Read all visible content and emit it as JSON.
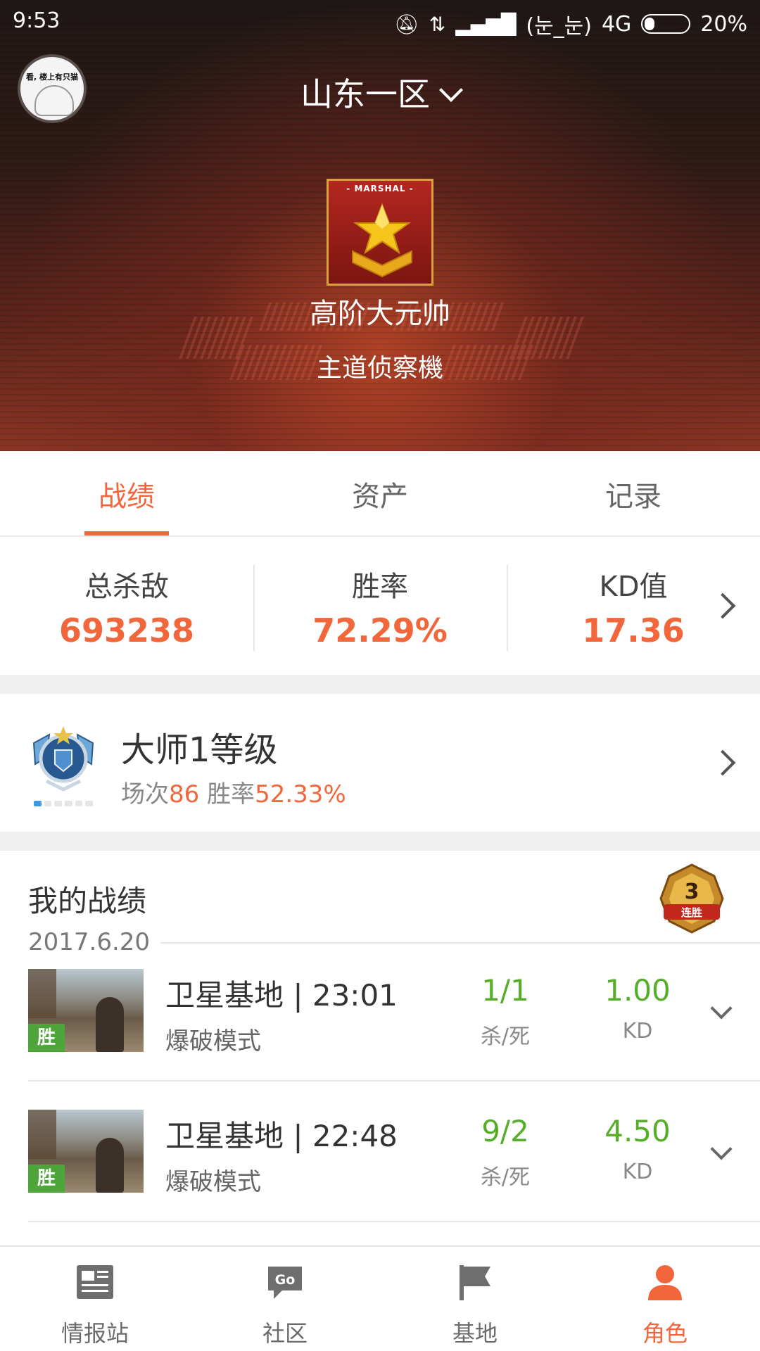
{
  "status_bar": {
    "time": "9:53",
    "carrier_face": "(눈_눈)",
    "network": "4G",
    "battery": "20%"
  },
  "header": {
    "server": "山东一区",
    "avatar_text": "看, 楼上有只猫",
    "rank_ribbon": "MARSHAL",
    "rank_name": "高阶大元帅",
    "player_name": "主道侦察機"
  },
  "tabs": [
    {
      "label": "战绩",
      "active": true
    },
    {
      "label": "资产",
      "active": false
    },
    {
      "label": "记录",
      "active": false
    }
  ],
  "stats": [
    {
      "label": "总杀敌",
      "value": "693238"
    },
    {
      "label": "胜率",
      "value": "72.29%"
    },
    {
      "label": "KD值",
      "value": "17.36"
    }
  ],
  "level": {
    "title": "大师1等级",
    "games_label": "场次",
    "games_value": "86",
    "winrate_label": " 胜率",
    "winrate_value": "52.33%"
  },
  "records": {
    "title": "我的战绩",
    "streak_number": "3",
    "streak_label": "连胜",
    "date": "2017.6.20",
    "matches": [
      {
        "name": "卫星基地 | 23:01",
        "mode": "爆破模式",
        "result": "胜",
        "kills_deaths": "1/1",
        "kd_label": "杀/死",
        "kd": "1.00",
        "kd_value_label": "KD"
      },
      {
        "name": "卫星基地 | 22:48",
        "mode": "爆破模式",
        "result": "胜",
        "kills_deaths": "9/2",
        "kd_label": "杀/死",
        "kd": "4.50",
        "kd_value_label": "KD"
      }
    ]
  },
  "bottom_nav": [
    {
      "label": "情报站",
      "icon": "newspaper-icon",
      "active": false
    },
    {
      "label": "社区",
      "icon": "chat-go-icon",
      "active": false
    },
    {
      "label": "基地",
      "icon": "flag-icon",
      "active": false
    },
    {
      "label": "角色",
      "icon": "person-icon",
      "active": true
    }
  ],
  "colors": {
    "accent": "#f2663b",
    "win_green": "#55ad28"
  }
}
